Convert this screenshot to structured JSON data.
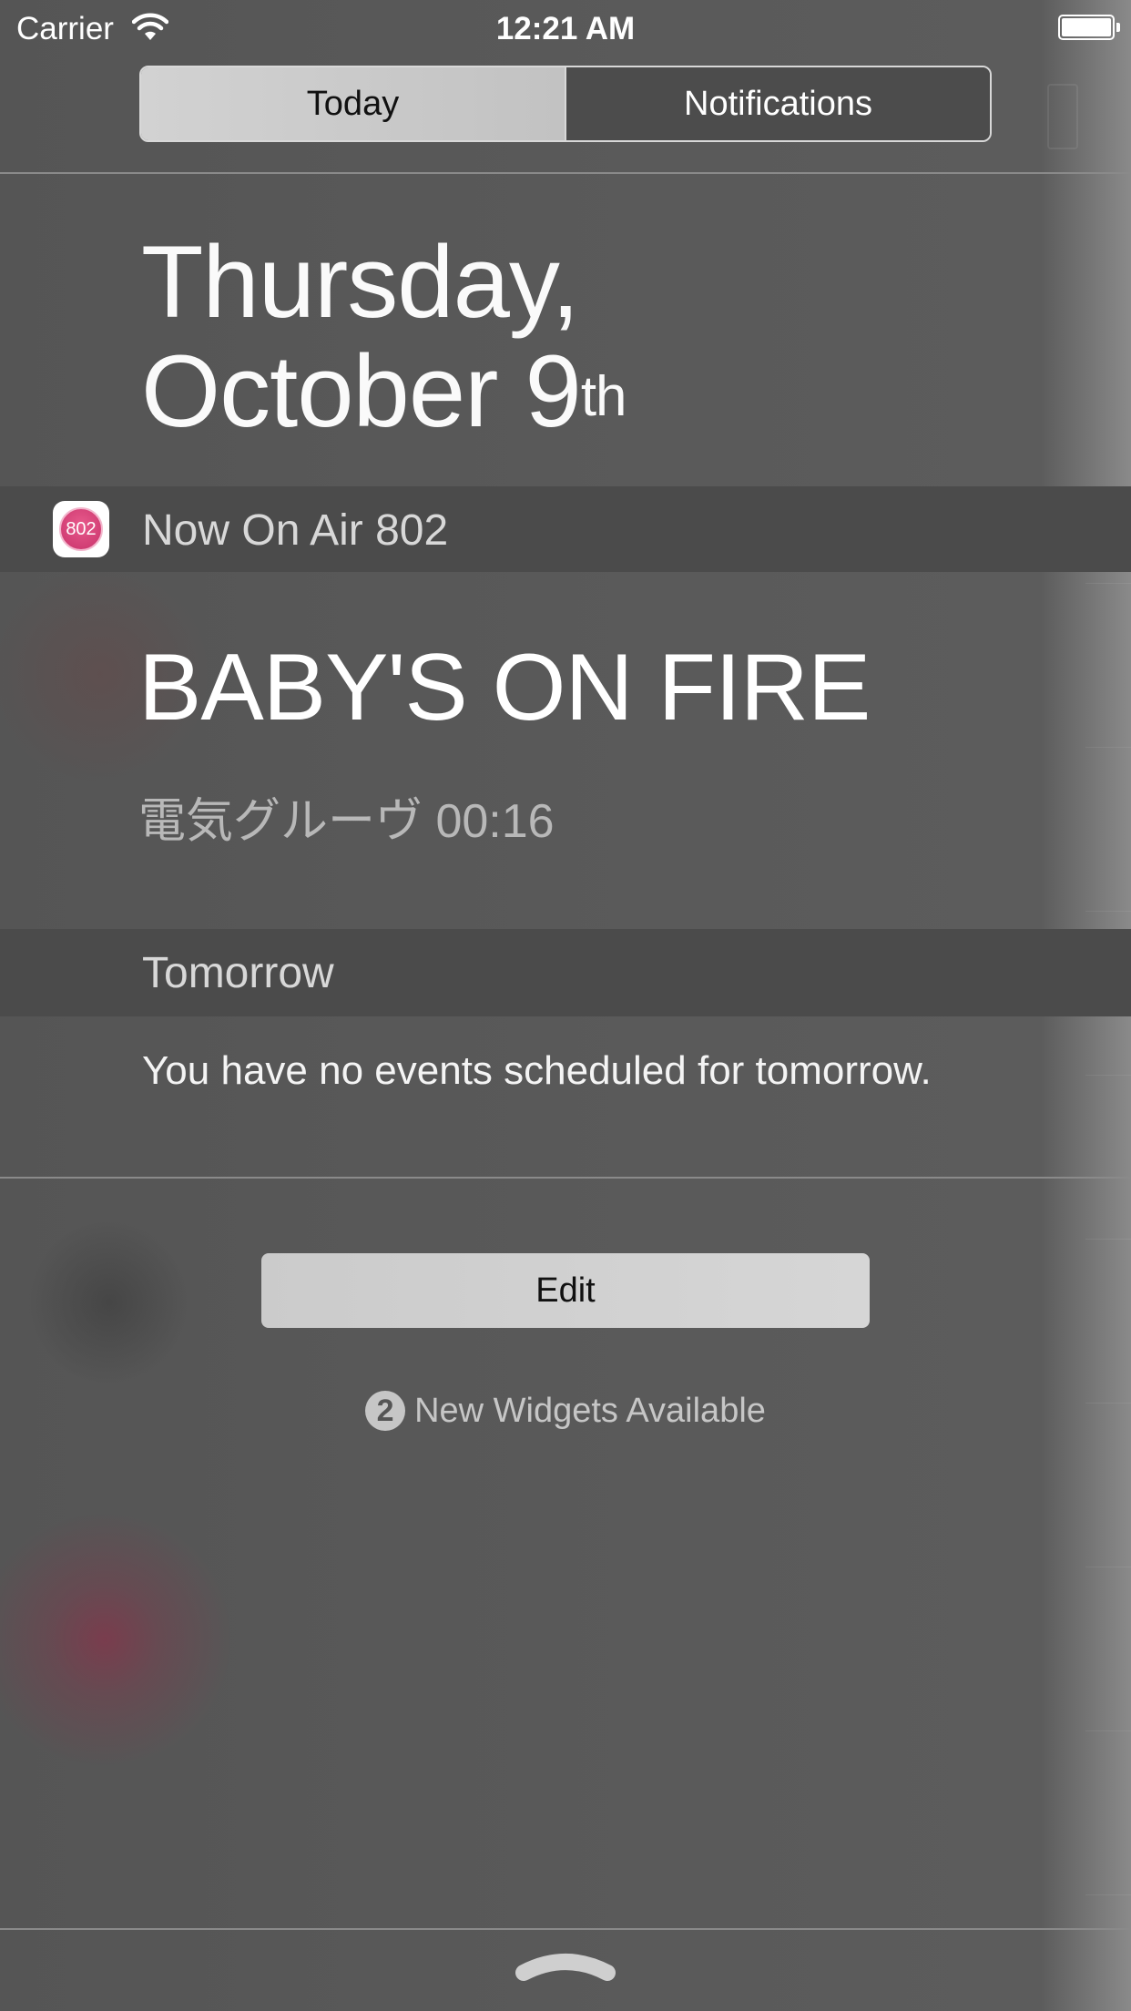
{
  "status_bar": {
    "carrier": "Carrier",
    "time": "12:21 AM"
  },
  "segmented_control": {
    "today_label": "Today",
    "notifications_label": "Notifications",
    "selected": "Today"
  },
  "date": {
    "line1": "Thursday,",
    "line2_main": "October 9",
    "line2_suffix": "th"
  },
  "widget": {
    "app_name": "Now On Air 802",
    "app_icon_text": "802",
    "song_title": "BABY'S ON FIRE",
    "song_info": "電気グルーヴ 00:16"
  },
  "tomorrow": {
    "header": "Tomorrow",
    "message": "You have no events scheduled for tomorrow."
  },
  "edit_label": "Edit",
  "new_widgets": {
    "count": "2",
    "label": "New Widgets Available"
  },
  "colors": {
    "background": "#585858",
    "header_band": "#4b4b4b",
    "accent_pink": "#c8336b"
  }
}
